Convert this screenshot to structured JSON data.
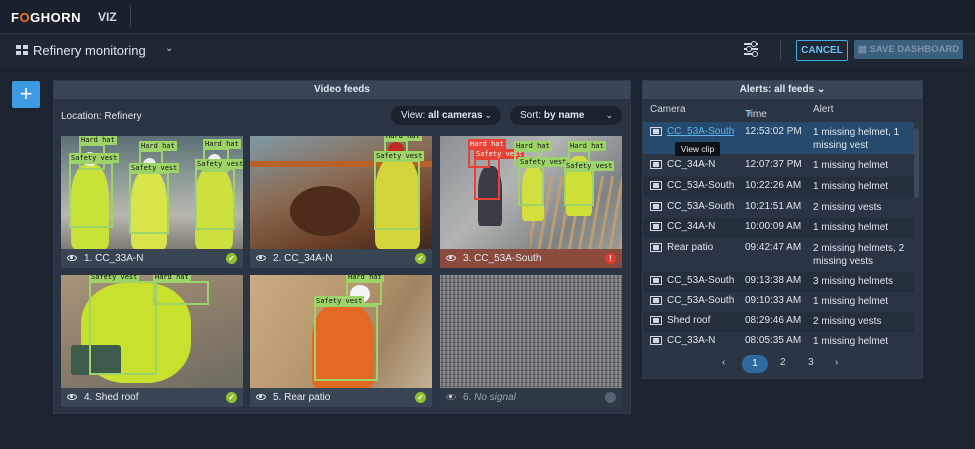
{
  "header": {
    "logo_part1": "F",
    "logo_o": "O",
    "logo_part2": "GHORN",
    "product": "VIZ"
  },
  "toolbar": {
    "dashboard_title": "Refinery monitoring",
    "cancel_label": "CANCEL",
    "save_label": "SAVE DASHBOARD",
    "add_label": "+"
  },
  "video_panel": {
    "title": "Video feeds",
    "location": "Location: Refinery",
    "view_prefix": "View:",
    "view_value": "all cameras",
    "sort_prefix": "Sort:",
    "sort_value": "by name",
    "tiles": [
      {
        "label": "1. CC_33A-N",
        "status": "ok"
      },
      {
        "label": "2. CC_34A-N",
        "status": "ok"
      },
      {
        "label": "3. CC_53A-South",
        "status": "alert"
      },
      {
        "label": "4. Shed roof",
        "status": "ok"
      },
      {
        "label": "5. Rear patio",
        "status": "ok"
      },
      {
        "label": "6.",
        "label_italic": "No signal",
        "status": "offline"
      }
    ],
    "detection_labels": {
      "hard_hat": "Hard hat",
      "safety_vest": "Safety vest"
    }
  },
  "alerts_panel": {
    "title": "Alerts: all feeds",
    "columns": {
      "camera": "Camera",
      "time": "Time",
      "alert": "Alert"
    },
    "tooltip": "View clip",
    "rows": [
      {
        "camera": "CC_53A-South",
        "time": "12:53:02 PM",
        "alert": "1 missing helmet, 1 missing vest"
      },
      {
        "camera": "CC_34A-N",
        "time": "12:07:37 PM",
        "alert": "1 missing helmet"
      },
      {
        "camera": "CC_53A-South",
        "time": "10:22:26 AM",
        "alert": "1 missing helmet"
      },
      {
        "camera": "CC_53A-South",
        "time": "10:21:51 AM",
        "alert": "2 missing vests"
      },
      {
        "camera": "CC_34A-N",
        "time": "10:00:09 AM",
        "alert": "1 missing helmet"
      },
      {
        "camera": "Rear patio",
        "time": "09:42:47 AM",
        "alert": "2 missing helmets, 2 missing vests"
      },
      {
        "camera": "CC_53A-South",
        "time": "09:13:38 AM",
        "alert": "3 missing helmets"
      },
      {
        "camera": "CC_53A-South",
        "time": "09:10:33 AM",
        "alert": "1 missing helmet"
      },
      {
        "camera": "Shed roof",
        "time": "08:29:46 AM",
        "alert": "2 missing vests"
      },
      {
        "camera": "CC_33A-N",
        "time": "08:05:35 AM",
        "alert": "1 missing helmet"
      }
    ],
    "pagination": {
      "prev": "‹",
      "pages": [
        "1",
        "2",
        "3"
      ],
      "next": "›",
      "current": "1"
    }
  },
  "colors": {
    "accent": "#3c9be0",
    "ok": "#8fc12f",
    "alert": "#e5372b",
    "brand_orange": "#ff6a1a",
    "detect": "#9ed36a"
  }
}
